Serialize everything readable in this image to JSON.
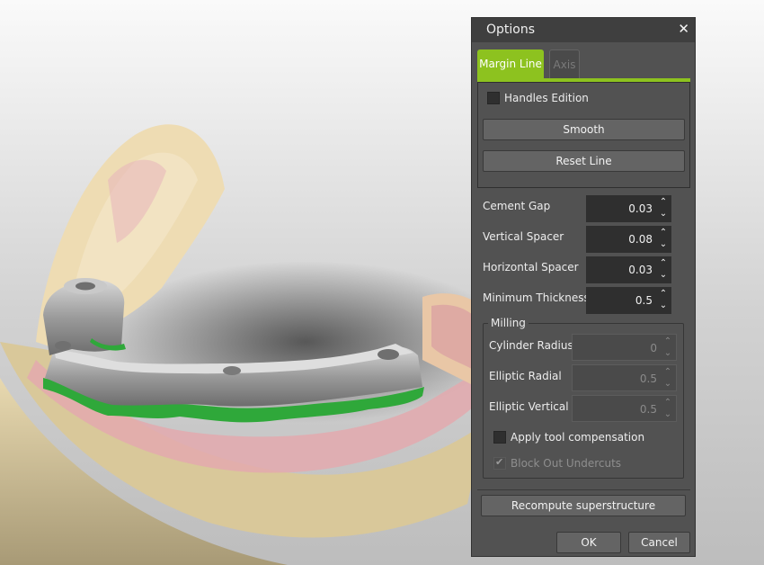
{
  "dialog": {
    "title": "Options",
    "close_glyph": "✕",
    "tabs": [
      {
        "label": "Margin Line",
        "active": true
      },
      {
        "label": "Axis",
        "active": false
      }
    ],
    "handles_edition_label": "Handles Edition",
    "handles_edition_checked": false,
    "smooth_label": "Smooth",
    "reset_line_label": "Reset Line",
    "params": [
      {
        "label": "Cement Gap",
        "value": "0.03"
      },
      {
        "label": "Vertical Spacer",
        "value": "0.08"
      },
      {
        "label": "Horizontal Spacer",
        "value": "0.03"
      },
      {
        "label": "Minimum Thickness",
        "value": "0.5"
      }
    ],
    "milling": {
      "title": "Milling",
      "fields": [
        {
          "label": "Cylinder Radius",
          "value": "0"
        },
        {
          "label": "Elliptic Radial",
          "value": "0.5"
        },
        {
          "label": "Elliptic Vertical",
          "value": "0.5"
        }
      ],
      "apply_tool_label": "Apply tool compensation",
      "apply_tool_checked": false,
      "block_out_label": "Block Out Undercuts",
      "block_out_checked": true
    },
    "recompute_label": "Recompute superstructure",
    "ok_label": "OK",
    "cancel_label": "Cancel",
    "accent_color": "#8dc21f"
  },
  "viewport": {
    "icons": [
      "dental-model-icon",
      "implant-bar-icon"
    ],
    "margin_color": "#2fa83a"
  }
}
